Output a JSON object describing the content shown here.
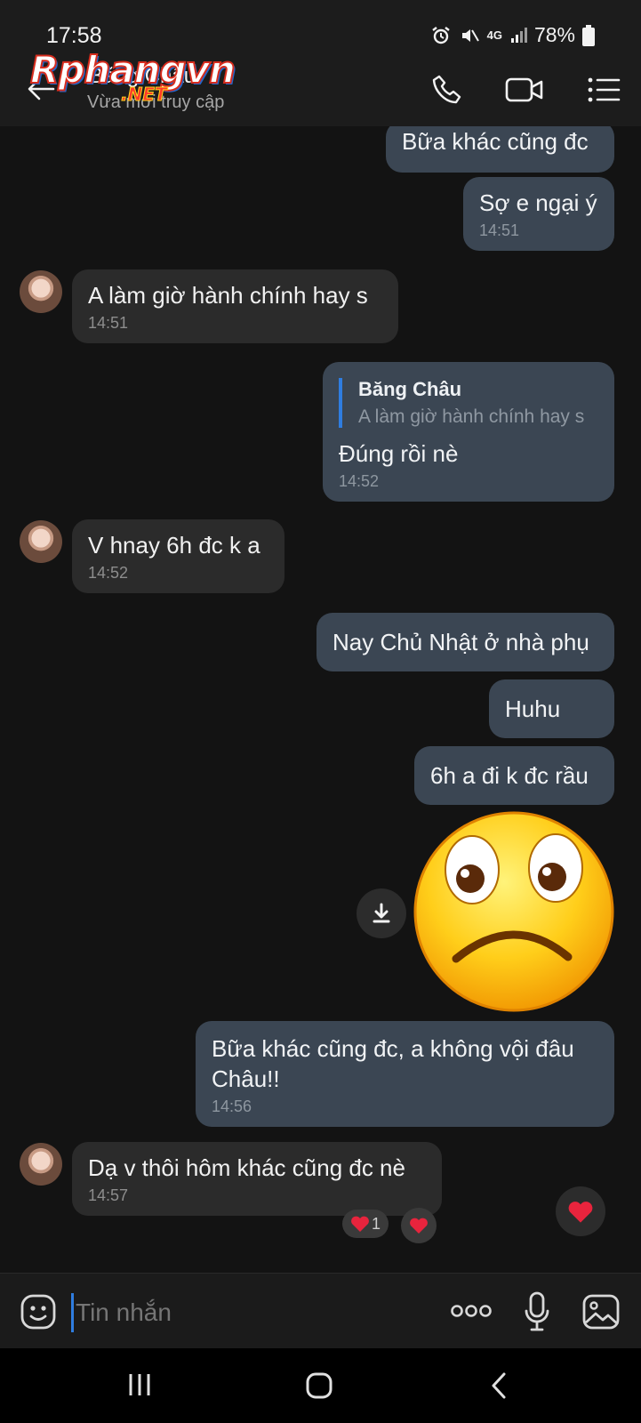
{
  "status_bar": {
    "time": "17:58",
    "battery": "78%",
    "network": "4G"
  },
  "header": {
    "contact_name": "Băng Châu",
    "status": "Vừa mới truy cập",
    "watermark_main": "Rphangvn",
    "watermark_sub": ".NET"
  },
  "messages": [
    {
      "dir": "out",
      "text": "Bữa khác cũng đc"
    },
    {
      "dir": "out",
      "text": "Sợ e ngại ý",
      "time": "14:51"
    },
    {
      "dir": "in",
      "text": "A làm giờ hành chính hay s",
      "time": "14:51"
    },
    {
      "dir": "out",
      "quote_author": "Băng Châu",
      "quote_text": "A làm giờ hành chính hay s",
      "text": "Đúng rồi nè",
      "time": "14:52"
    },
    {
      "dir": "in",
      "text": "V hnay 6h đc k a",
      "time": "14:52"
    },
    {
      "dir": "out",
      "text": "Nay Chủ Nhật ở nhà phụ"
    },
    {
      "dir": "out",
      "text": "Huhu"
    },
    {
      "dir": "out",
      "text": "6h a đi k đc rầu"
    },
    {
      "dir": "out",
      "line1": "Bữa khác cũng đc, a không vội đâu",
      "line2": "Châu!!",
      "time": "14:56"
    },
    {
      "dir": "in",
      "text": "Dạ v thôi hôm khác cũng đc nè",
      "time": "14:57",
      "reaction_count": "1"
    }
  ],
  "input": {
    "placeholder": "Tin nhắn"
  },
  "colors": {
    "outgoing_bubble": "#3b4653",
    "incoming_bubble": "#2b2b2b",
    "accent": "#2f7de0",
    "heart": "#e8243d"
  }
}
